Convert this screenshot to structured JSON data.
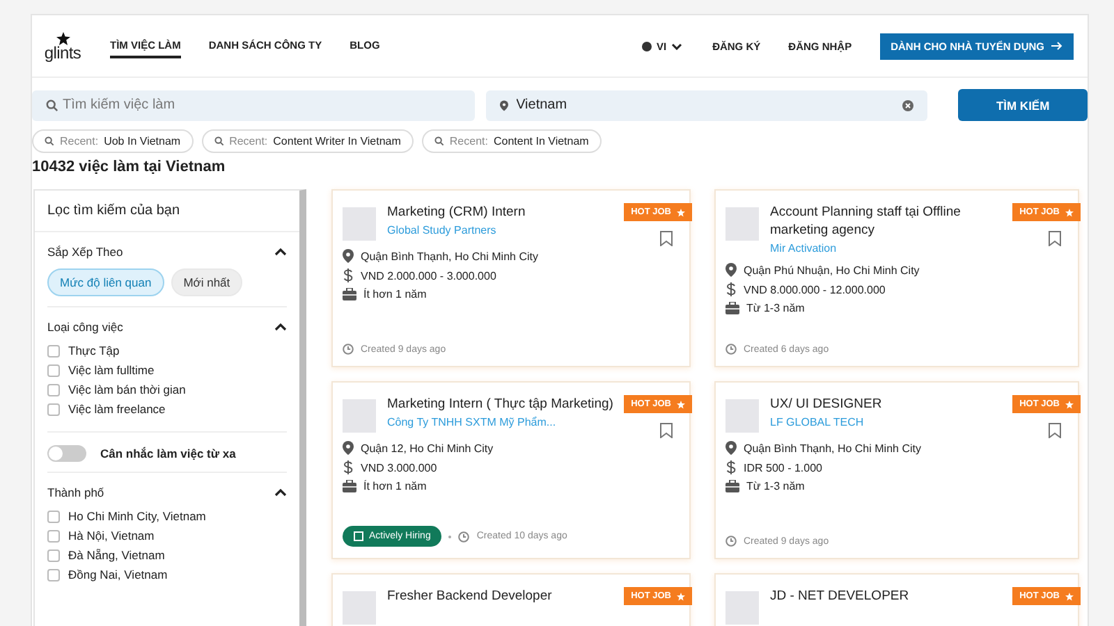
{
  "nav": {
    "logo": "glints",
    "links": [
      {
        "label": "TÌM VIỆC LÀM",
        "selected": true
      },
      {
        "label": "DANH SÁCH CÔNG TY",
        "selected": false
      },
      {
        "label": "BLOG",
        "selected": false
      }
    ],
    "language": "VI",
    "register": "ĐĂNG KÝ",
    "login": "ĐĂNG NHẬP",
    "employer_button": "DÀNH CHO NHÀ TUYỂN DỤNG"
  },
  "search": {
    "keyword_placeholder": "Tìm kiếm việc làm",
    "location_value": "Vietnam",
    "button": "TÌM KIẾM"
  },
  "recent": [
    {
      "prefix": "Recent:",
      "term": "Uob In Vietnam"
    },
    {
      "prefix": "Recent:",
      "term": "Content Writer In Vietnam"
    },
    {
      "prefix": "Recent:",
      "term": "Content In Vietnam"
    }
  ],
  "result_count": "10432 việc làm tại Vietnam",
  "filters": {
    "title": "Lọc tìm kiếm của bạn",
    "sort": {
      "title": "Sắp Xếp Theo",
      "expanded": true,
      "options": [
        {
          "label": "Mức độ liên quan",
          "selected": true
        },
        {
          "label": "Mới nhất",
          "selected": false
        }
      ]
    },
    "job_type": {
      "title": "Loại công việc",
      "expanded": true,
      "options": [
        {
          "label": "Thực Tập",
          "checked": false
        },
        {
          "label": "Việc làm fulltime",
          "checked": false
        },
        {
          "label": "Việc làm bán thời gian",
          "checked": false
        },
        {
          "label": "Việc làm freelance",
          "checked": false
        }
      ]
    },
    "remote": {
      "label": "Cân nhắc làm việc từ xa",
      "on": false
    },
    "city": {
      "title": "Thành phố",
      "expanded": true,
      "options": [
        {
          "label": "Ho Chi Minh City, Vietnam",
          "checked": false
        },
        {
          "label": "Hà Nội, Vietnam",
          "checked": false
        },
        {
          "label": "Đà Nẵng, Vietnam",
          "checked": false
        },
        {
          "label": "Đồng Nai, Vietnam",
          "checked": false
        }
      ]
    }
  },
  "jobs": [
    {
      "title": "Marketing (CRM) Intern",
      "company": "Global Study Partners",
      "badge": "HOT JOB",
      "location": "Quận Bình Thạnh, Ho Chi Minh City",
      "salary": "VND 2.000.000 - 3.000.000",
      "experience": "Ít hơn 1 năm",
      "created": "Created 9 days ago"
    },
    {
      "title": "Account Planning staff tại Offline marketing agency",
      "company": "Mir Activation",
      "badge": "HOT JOB",
      "location": "Quận Phú Nhuận, Ho Chi Minh City",
      "salary": "VND 8.000.000 - 12.000.000",
      "experience": "Từ 1-3 năm",
      "created": "Created 6 days ago"
    },
    {
      "title": "Marketing Intern ( Thực tập Marketing)",
      "company": "Công Ty TNHH SXTM Mỹ Phẩm...",
      "badge": "HOT JOB",
      "location": "Quận 12, Ho Chi Minh City",
      "salary": "VND 3.000.000",
      "experience": "Ít hơn 1 năm",
      "created": "Created 10 days ago",
      "hiring": "Actively Hiring"
    },
    {
      "title": "UX/ UI DESIGNER",
      "company": "LF GLOBAL TECH",
      "badge": "HOT JOB",
      "location": "Quận Bình Thạnh, Ho Chi Minh City",
      "salary": "IDR 500 - 1.000",
      "experience": "Từ 1-3 năm",
      "created": "Created 9 days ago"
    },
    {
      "title": "Fresher Backend Developer",
      "badge": "HOT JOB"
    },
    {
      "title": "JD - NET DEVELOPER",
      "badge": "HOT JOB"
    }
  ]
}
